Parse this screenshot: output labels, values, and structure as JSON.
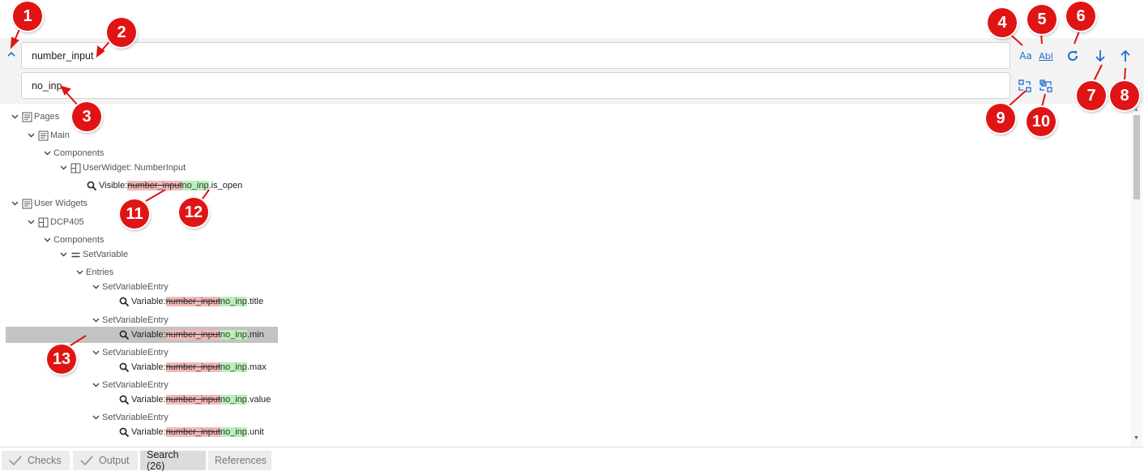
{
  "search": {
    "find_value": "number_input",
    "replace_value": "no_inp"
  },
  "toolbar": {
    "match_case_label": "Aa",
    "whole_word_label": "Abl"
  },
  "icons": {
    "collapse": "chevron-up-icon",
    "refresh": "refresh-icon",
    "next": "arrow-down-icon",
    "previous": "arrow-up-icon",
    "replace_one": "replace-icon",
    "replace_all": "replace-all-icon",
    "result": "search-icon",
    "page": "page-icon",
    "widget": "widget-icon",
    "set_variable": "equals-icon"
  },
  "tree": {
    "pages": "Pages",
    "main": "Main",
    "components_1": "Components",
    "user_widget": "UserWidget: NumberInput",
    "visible_prefix": "Visible: ",
    "visible_del": "number_input",
    "visible_ins": "no_inp",
    "visible_suffix": ".is_open",
    "user_widgets": "User Widgets",
    "dcp405": "DCP405",
    "components_2": "Components",
    "set_variable": "SetVariable",
    "entries": "Entries",
    "entry_label": "SetVariableEntry",
    "variable_prefix": "Variable: ",
    "del": "number_input",
    "ins": "no_inp",
    "suffixes": [
      ".title",
      ".min",
      ".max",
      ".value",
      ".unit"
    ]
  },
  "tabs": [
    "Checks",
    "Output",
    "Search (26)",
    "References"
  ],
  "callouts": [
    "1",
    "2",
    "3",
    "4",
    "5",
    "6",
    "7",
    "8",
    "9",
    "10",
    "11",
    "12",
    "13"
  ],
  "colors": {
    "accent": "#1e6fcf",
    "callout": "#e01414",
    "deleted": "#f4b8b8",
    "inserted": "#b8f0b8",
    "selected": "#c3c3c3"
  }
}
